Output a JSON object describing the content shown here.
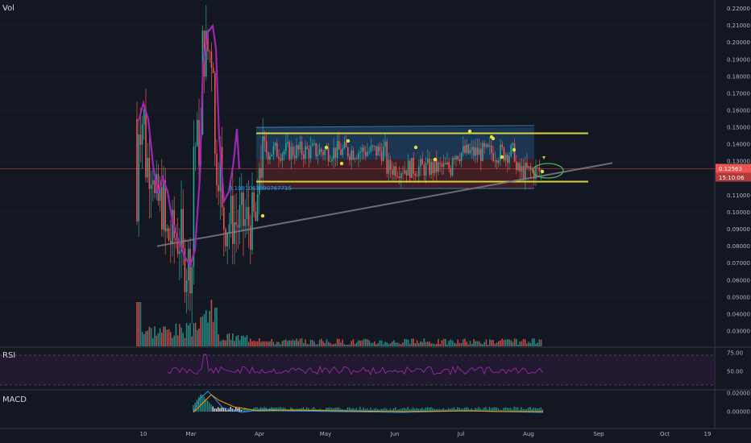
{
  "colors": {
    "background": "#131722",
    "grid": "#1e222d",
    "up": "#26a69a",
    "down": "#ef5350",
    "channel_fill": "#1f3b5c",
    "channel_lower_fill": "#4a1f24",
    "yellow": "#d4d43a",
    "trend": "#787b86",
    "purple": "#9c27b0",
    "rsi_line": "#9c27b0",
    "macd_line": "#2196f3",
    "signal_line": "#ff9800",
    "price_tag": "#ef5350",
    "annotation": "#2196f3"
  },
  "panes": {
    "main_label": "Vol",
    "rsi_label": "RSI",
    "macd_label": "MACD"
  },
  "chart_data": {
    "type": "candlestick",
    "price_axis": {
      "ylim": [
        0.021,
        0.225
      ],
      "ticks": [
        "0.03000",
        "0.04000",
        "0.05000",
        "0.06000",
        "0.07000",
        "0.08000",
        "0.09000",
        "0.10000",
        "0.11000",
        "0.12000",
        "0.13000",
        "0.14000",
        "0.15000",
        "0.16000",
        "0.17000",
        "0.18000",
        "0.19000",
        "0.20000",
        "0.21000",
        "0.22000"
      ]
    },
    "time_axis": {
      "labels": [
        "10",
        "Mar",
        "Apr",
        "May",
        "Jun",
        "Jul",
        "Aug",
        "Sep",
        "Oct",
        "19"
      ]
    },
    "current_price": {
      "value": "0.12563",
      "countdown": "15:10:06"
    },
    "annotation": "0.1081063890767715",
    "channel": {
      "upper": 0.15,
      "mid": 0.131,
      "lower": 0.114,
      "yellow_upper": 0.1465,
      "yellow_lower": 0.118
    },
    "trendline": {
      "start": [
        0.08
      ],
      "end": [
        0.129
      ]
    },
    "rsi": {
      "ticks": [
        "75.00",
        "50.00"
      ],
      "upper_band": 70,
      "lower_band": 30
    },
    "macd": {
      "ticks": [
        "0.02000",
        "0.00000"
      ]
    }
  }
}
